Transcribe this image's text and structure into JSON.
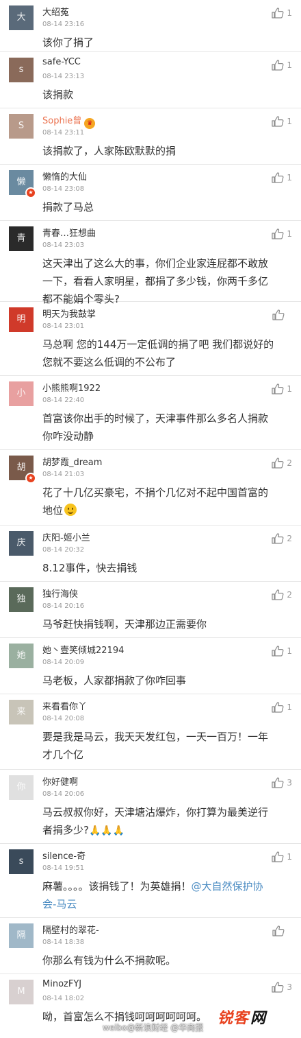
{
  "colors": {
    "username": "#333333",
    "username_orange": "#eb7350",
    "time": "#999999",
    "link": "#4a8bc2",
    "divider": "#e6e6e6",
    "vip_badge": "#e8421f"
  },
  "comments": [
    {
      "name": "大绍菟",
      "time": "08-14 23:16",
      "lines": [
        "该你了捐了"
      ],
      "likes": "1",
      "avatar_color": "#5a6a7a",
      "avatar_icon": "avatar-photo"
    },
    {
      "name": "safe-YCC",
      "time": "08-14 23:13",
      "lines": [
        "该捐款"
      ],
      "likes": "1",
      "avatar_color": "#8a6a5a",
      "avatar_icon": "avatar-photo"
    },
    {
      "name": "Sophie曾",
      "time": "08-14 23:11",
      "lines": [
        "该捐款了，人家陈欧默默的捐"
      ],
      "likes": "1",
      "avatar_color": "#b89a8a",
      "avatar_icon": "avatar-photo",
      "orange": true,
      "crown_icon": "crown-badge-icon"
    },
    {
      "name": "懒惰的大仙",
      "time": "08-14 23:08",
      "lines": [
        "捐款了马总"
      ],
      "likes": "1",
      "avatar_color": "#6a8aa0",
      "avatar_icon": "avatar-photo",
      "vip_icon": "vip-badge-icon"
    },
    {
      "name": "青春…狂想曲",
      "time": "08-14 23:03",
      "lines": [
        "这天津出了这么大的事，你们企业家连屁都不敢放",
        "一下，看看人家明星，都捐了多少钱，你两千多亿",
        "都不能娟个零头?"
      ],
      "likes": "1",
      "avatar_color": "#2a2a2a",
      "avatar_icon": "avatar-photo"
    },
    {
      "name": "明天为我鼓掌",
      "time": "08-14 23:01",
      "lines": [
        "马总啊 您的144万一定低调的捐了吧 我们都说好的",
        "您就不要这么低调的不公布了"
      ],
      "likes": "",
      "avatar_color": "#d03a2a",
      "avatar_icon": "avatar-photo"
    },
    {
      "name": "小熊熊啊1922",
      "time": "08-14 22:40",
      "lines": [
        "首富该你出手的时候了，天津事件那么多名人捐款",
        "你咋没动静"
      ],
      "likes": "1",
      "avatar_color": "#e8a0a0",
      "avatar_icon": "avatar-photo"
    },
    {
      "name": "胡梦霞_dream",
      "time": "08-14 21:03",
      "lines": [
        "花了十几亿买豪宅，不捐个几亿对不起中国首富的",
        "地位"
      ],
      "likes": "2",
      "avatar_color": "#7a5a4a",
      "avatar_icon": "avatar-photo",
      "vip_icon": "vip-badge-icon",
      "emoji_icon": "smile-emoji-icon"
    },
    {
      "name": "庆阳-姬小兰",
      "time": "08-14 20:32",
      "lines": [
        "8.12事件，快去捐钱"
      ],
      "likes": "2",
      "avatar_color": "#4a5a6a",
      "avatar_icon": "avatar-photo"
    },
    {
      "name": "独行海侠",
      "time": "08-14 20:16",
      "lines": [
        "马爷赶快捐钱啊，天津那边正需要你"
      ],
      "likes": "2",
      "avatar_color": "#5a6a5a",
      "avatar_icon": "avatar-photo"
    },
    {
      "name": "她丶壹笑倾城22194",
      "time": "08-14 20:09",
      "lines": [
        "马老板，人家都捐款了你咋回事"
      ],
      "likes": "1",
      "avatar_color": "#9ab0a0",
      "avatar_icon": "avatar-photo"
    },
    {
      "name": "来看看你丫",
      "time": "08-14 20:08",
      "lines": [
        "要是我是马云，我天天发红包，一天一百万！一年",
        "才几个亿"
      ],
      "likes": "1",
      "avatar_color": "#c8c4b8",
      "avatar_icon": "avatar-photo"
    },
    {
      "name": "你好健啊",
      "time": "08-14 20:06",
      "lines": [
        "马云叔叔你好，天津塘沽爆炸，你打算为最美逆行",
        "者捐多少?"
      ],
      "likes": "3",
      "avatar_color": "#e0e0e0",
      "avatar_icon": "avatar-photo",
      "pray_icon": "pray-hands-icon",
      "pray_glyphs": "🙏🙏🙏"
    },
    {
      "name": "silence-奇",
      "time": "08-14 19:51",
      "lines": [
        "麻薯。。。。该捐钱了！为英雄捐！"
      ],
      "link_suffix": "@大自然保护协",
      "extra_link_line": "会-马云",
      "likes": "1",
      "avatar_color": "#3a4a5a",
      "avatar_icon": "avatar-photo"
    },
    {
      "name": "隔壁村的翠花-",
      "time": "08-14 18:38",
      "lines": [
        "你那么有钱为什么不捐款呢。"
      ],
      "likes": "",
      "avatar_color": "#a0b8c8",
      "avatar_icon": "avatar-photo"
    },
    {
      "name": "MinozFYJ",
      "time": "08-14 18:02",
      "lines": [
        "呦，首富怎么不捐钱呵呵呵呵呵呵。"
      ],
      "likes": "3",
      "avatar_color": "#d8d0d0",
      "avatar_icon": "avatar-photo"
    }
  ],
  "watermark": {
    "text": "weibo@新浪财经 @华商报",
    "logo": "锐客",
    "logo_tail": "网"
  },
  "icons": {
    "like": "thumbs-up-icon"
  }
}
